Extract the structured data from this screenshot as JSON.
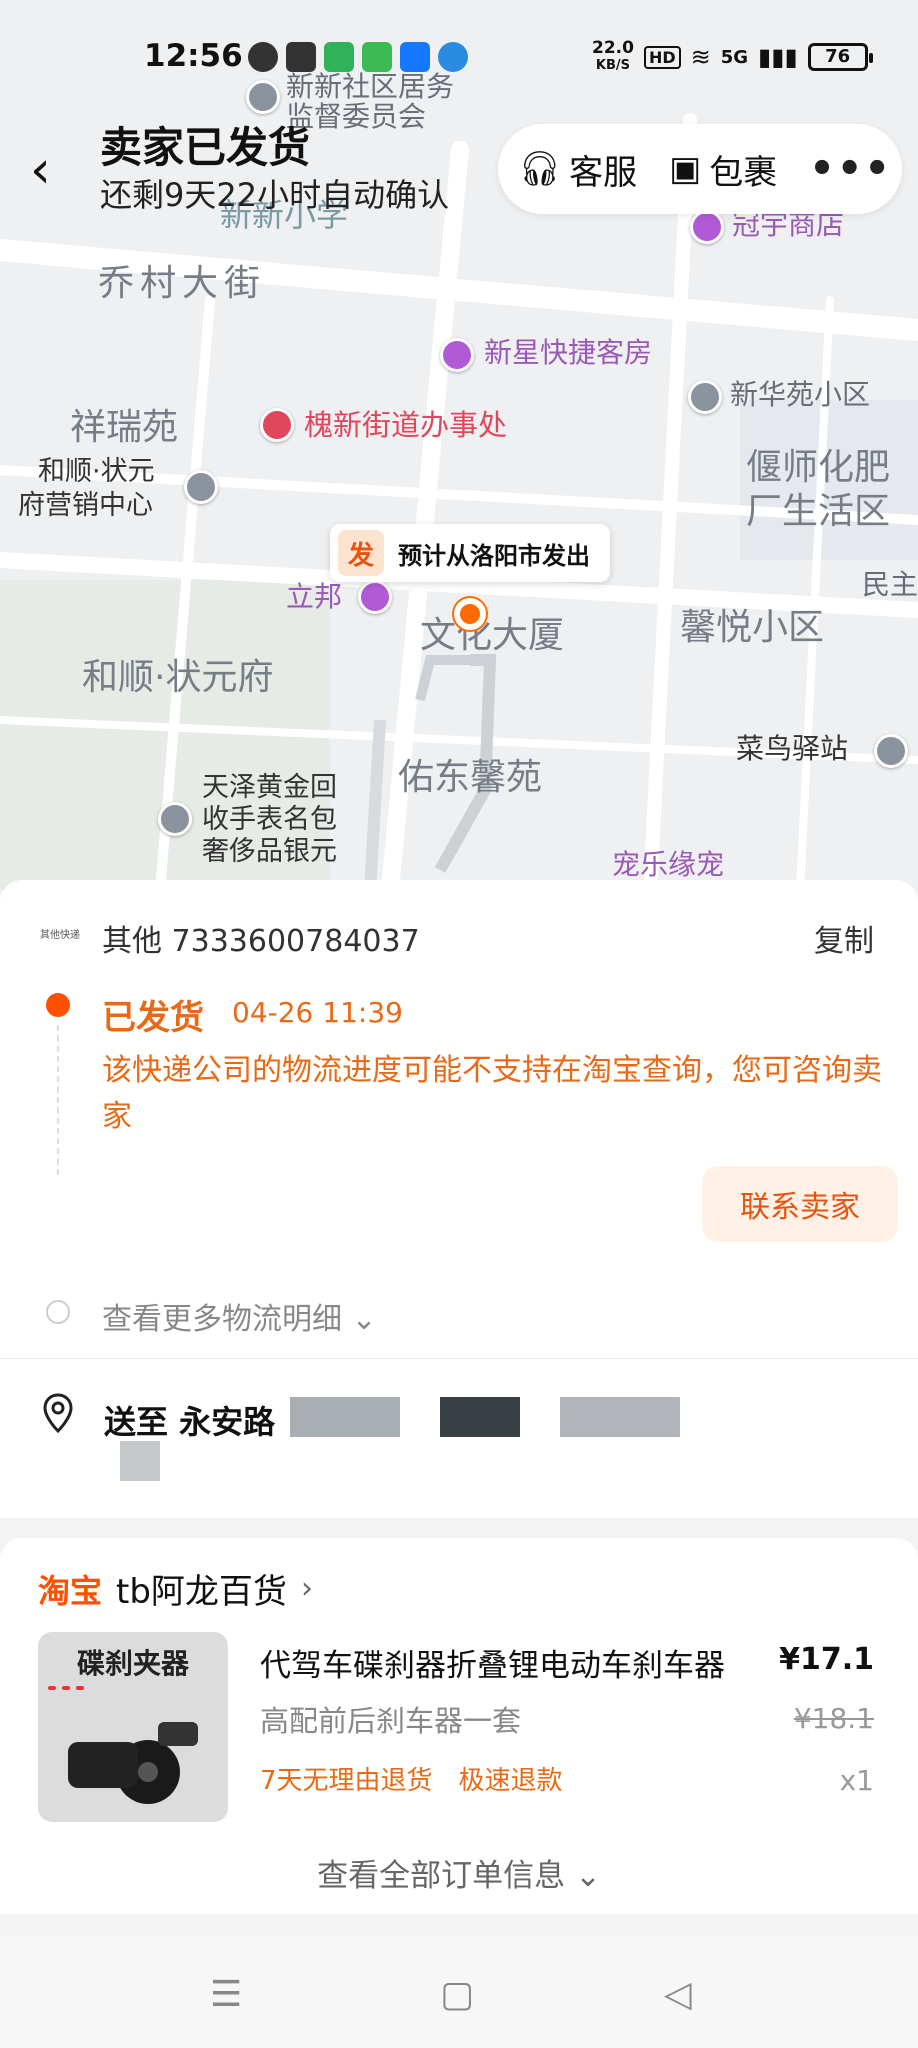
{
  "status_bar": {
    "time": "12:56",
    "speed": "22.0",
    "speed_unit": "KB/S",
    "hd": "HD",
    "network": "5G",
    "battery": "76"
  },
  "header": {
    "title": "卖家已发货",
    "subtitle": "还剩9天22小时自动确认",
    "service_label": "客服",
    "package_label": "包裹",
    "more_label": "•••",
    "back_icon": "chevron-left-icon",
    "service_icon": "headset-icon",
    "package_icon": "package-icon",
    "more_icon": "more-dots-icon"
  },
  "map": {
    "callout_badge": "发",
    "callout_text": "预计从洛阳市发出",
    "labels": [
      "新新社区居务",
      "监督委员会",
      "新新小学",
      "冠宇商店",
      "乔村大街",
      "新星快捷客房",
      "新华苑小区",
      "祥瑞苑",
      "槐新街道办事处",
      "偃师化肥",
      "厂生活区",
      "和顺·状元",
      "府营销中心",
      "立邦",
      "文化大厦",
      "馨悦小区",
      "民主",
      "和顺·状元府",
      "菜鸟驿站",
      "佑东馨苑",
      "天泽黄金回",
      "收手表名包",
      "奢侈品银元",
      "宠乐缘宠"
    ]
  },
  "logistics": {
    "carrier_logo": "其他快递",
    "carrier_tracking": "其他 7333600784037",
    "copy_label": "复制",
    "status": "已发货",
    "status_time": "04-26 11:39",
    "note": "该快递公司的物流进度可能不支持在淘宝查询，您可咨询卖家",
    "contact_label": "联系卖家",
    "more_label": "查看更多物流明细"
  },
  "delivery": {
    "address_prefix": "送至 永安路",
    "location_icon": "location-pin-icon"
  },
  "order": {
    "platform": "淘宝",
    "shop_name": "tb阿龙百货",
    "thumb_title": "碟刹夹器",
    "product_name": "代驾车碟刹器折叠锂电动车刹车器",
    "product_spec": "高配前后刹车器一套",
    "tag1": "7天无理由退货",
    "tag2": "极速退款",
    "price": "¥17.1",
    "original_price": "¥18.1",
    "quantity": "x1",
    "all_info_label": "查看全部订单信息"
  },
  "nav": {
    "menu_icon": "menu-icon",
    "home_icon": "home-square-icon",
    "back_icon": "back-triangle-icon"
  }
}
